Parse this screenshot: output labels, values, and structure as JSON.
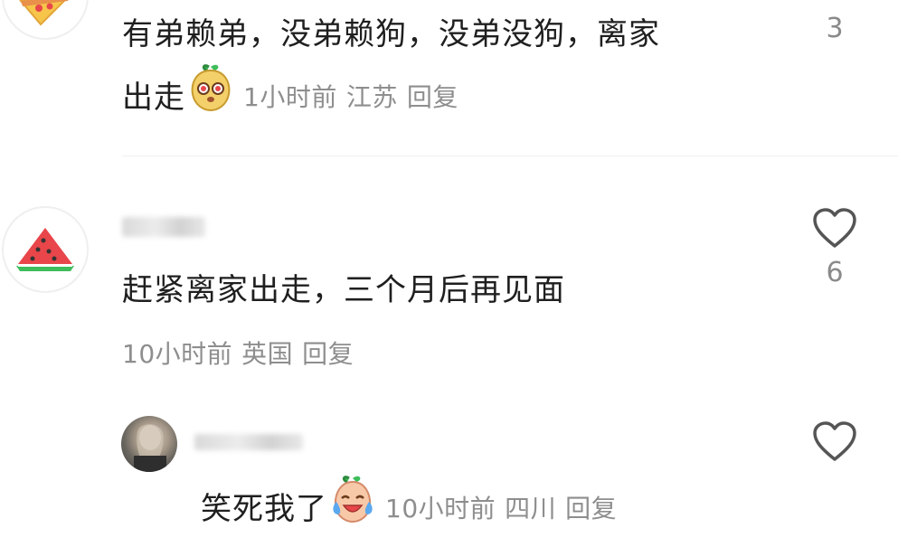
{
  "comment1": {
    "text_line1": "有弟赖弟，没弟赖狗，没弟没狗，离家",
    "text_line2": "出走",
    "time": "1小时前",
    "location": "江苏",
    "reply_label": "回复",
    "like_count": "3",
    "avatar_icon": "pizza-icon",
    "emoji_icon": "pear-face-emoji"
  },
  "comment2": {
    "username": "",
    "text": "赶紧离家出走，三个月后再见面",
    "time": "10小时前",
    "location": "英国",
    "reply_label": "回复",
    "like_count": "6",
    "avatar_icon": "watermelon-icon",
    "like_icon": "heart-outline-icon"
  },
  "reply1": {
    "username": "",
    "text": "笑死我了",
    "time": "10小时前",
    "location": "四川",
    "reply_label": "回复",
    "avatar_icon": "user-photo-avatar",
    "emoji_icon": "laughing-crying-emoji",
    "like_icon": "heart-outline-icon"
  },
  "colors": {
    "text": "#1f1f1f",
    "meta": "#8e8e8e",
    "watermelon_red": "#e8464a",
    "watermelon_green": "#3ebd5b",
    "heart": "#555555"
  }
}
